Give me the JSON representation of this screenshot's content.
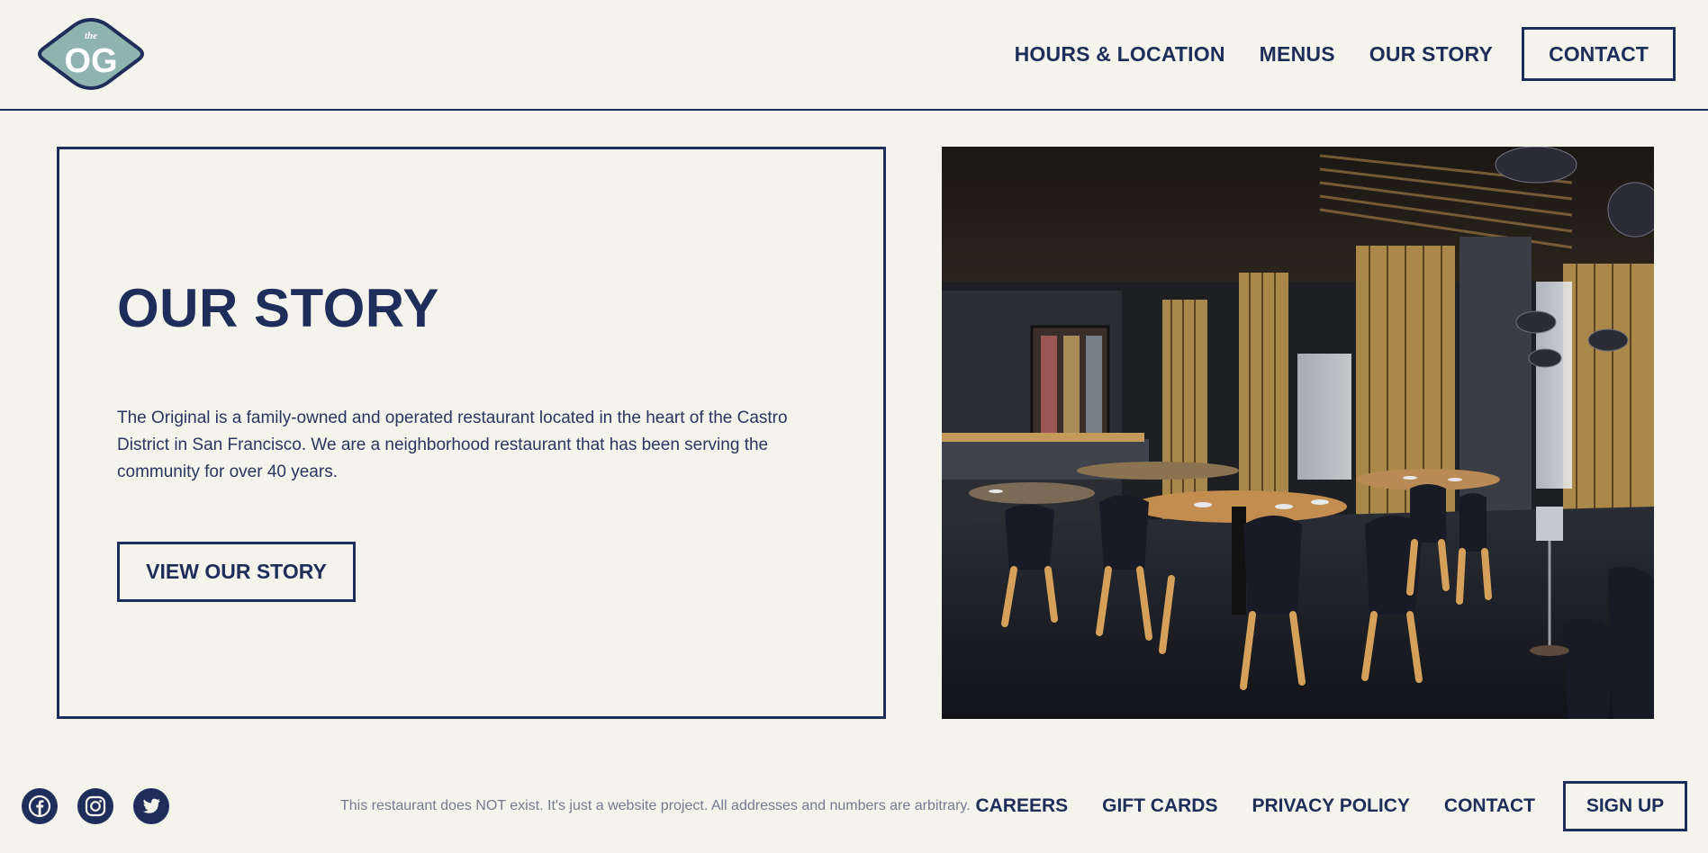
{
  "brand": {
    "logo_small": "the",
    "logo_main": "OG",
    "logo_fill": "#8fb3ae",
    "primary_color": "#1f2d5a",
    "background_color": "#f4f3ec"
  },
  "nav": {
    "items": [
      {
        "label": "HOURS & LOCATION"
      },
      {
        "label": "MENUS"
      },
      {
        "label": "OUR STORY"
      }
    ],
    "contact_label": "CONTACT"
  },
  "story": {
    "title": "OUR STORY",
    "body": "The Original is a family-owned and operated restaurant located in the heart of the Castro District in San Francisco. We are a neighborhood restaurant that has been serving the community for over 40 years.",
    "button_label": "VIEW OUR STORY"
  },
  "photo": {
    "subject": "restaurant dining room interior"
  },
  "footer": {
    "social_icons": [
      "facebook-icon",
      "instagram-icon",
      "twitter-icon"
    ],
    "disclaimer": "This restaurant does NOT exist. It's just a website project. All addresses and numbers are arbitrary.",
    "links": [
      {
        "label": "CAREERS"
      },
      {
        "label": "GIFT CARDS"
      },
      {
        "label": "PRIVACY POLICY"
      },
      {
        "label": "CONTACT"
      }
    ],
    "signup_label": "SIGN UP"
  }
}
